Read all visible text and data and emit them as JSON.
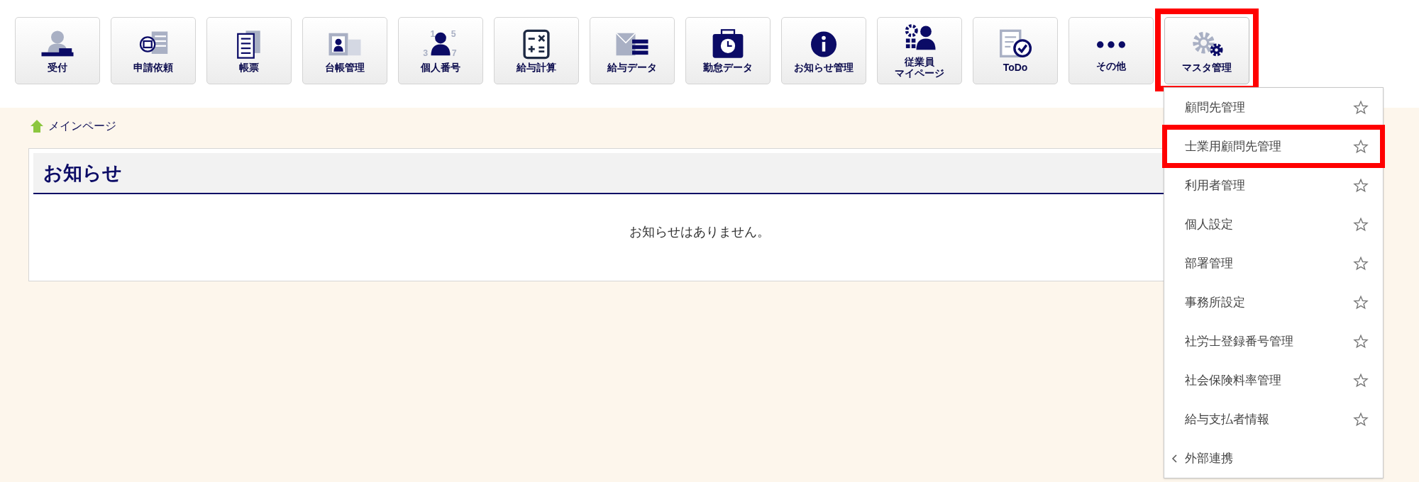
{
  "toolbar": [
    {
      "label": "受付",
      "highlighted": false
    },
    {
      "label": "申請依頼",
      "highlighted": false
    },
    {
      "label": "帳票",
      "highlighted": false
    },
    {
      "label": "台帳管理",
      "highlighted": false
    },
    {
      "label": "個人番号",
      "highlighted": false
    },
    {
      "label": "給与計算",
      "highlighted": false
    },
    {
      "label": "給与データ",
      "highlighted": false
    },
    {
      "label": "勤怠データ",
      "highlighted": false
    },
    {
      "label": "お知らせ管理",
      "highlighted": false
    },
    {
      "label": "従業員",
      "label_line_2": "マイページ",
      "highlighted": false
    },
    {
      "label": "ToDo",
      "highlighted": false
    },
    {
      "label": "その他",
      "highlighted": false
    },
    {
      "label": "マスタ管理",
      "highlighted": true
    }
  ],
  "icon_numbers": [
    "1",
    "5",
    "3",
    "7"
  ],
  "breadcrumb": {
    "label": "メインページ"
  },
  "notice": {
    "title": "お知らせ",
    "message": "お知らせはありません。"
  },
  "menu": {
    "items": [
      {
        "label": "顧問先管理",
        "kind": "favorite",
        "highlighted": false
      },
      {
        "label": "士業用顧問先管理",
        "kind": "favorite",
        "highlighted": true
      },
      {
        "label": "利用者管理",
        "kind": "favorite",
        "highlighted": false
      },
      {
        "label": "個人設定",
        "kind": "favorite",
        "highlighted": false
      },
      {
        "label": "部署管理",
        "kind": "favorite",
        "highlighted": false
      },
      {
        "label": "事務所設定",
        "kind": "favorite",
        "highlighted": false
      },
      {
        "label": "社労士登録番号管理",
        "kind": "favorite",
        "highlighted": false
      },
      {
        "label": "社会保険料率管理",
        "kind": "favorite",
        "highlighted": false
      },
      {
        "label": "給与支払者情報",
        "kind": "favorite",
        "highlighted": false
      },
      {
        "label": "外部連携",
        "kind": "submenu",
        "highlighted": false
      }
    ]
  }
}
